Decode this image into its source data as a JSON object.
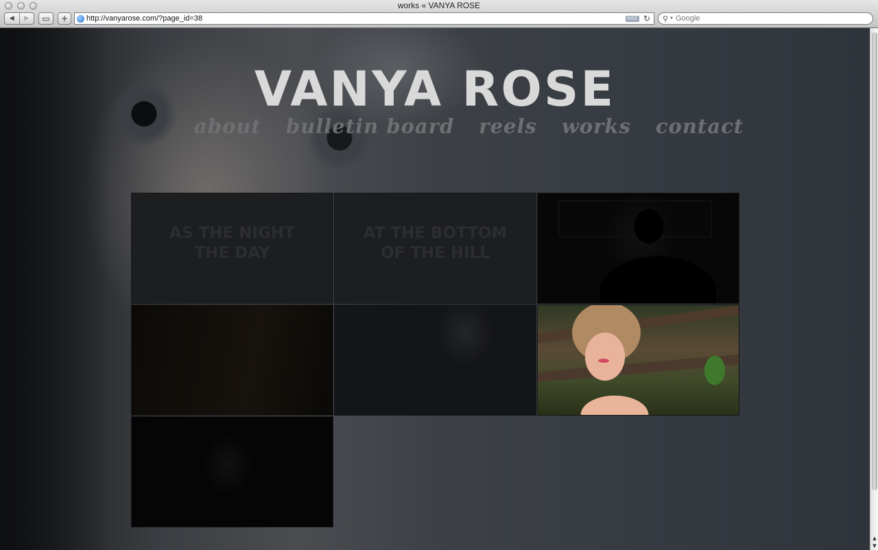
{
  "window": {
    "title": "works « VANYA ROSE"
  },
  "toolbar": {
    "back_icon": "back-arrow-icon",
    "forward_icon": "forward-arrow-icon",
    "add_bookmark_label": "+",
    "url": "http://vanyarose.com/?page_id=38",
    "rss_label": "RSS",
    "search_placeholder": "Google"
  },
  "site": {
    "title": "VANYA ROSE",
    "nav": [
      {
        "label": "about"
      },
      {
        "label": "bulletin board"
      },
      {
        "label": "reels"
      },
      {
        "label": "works"
      },
      {
        "label": "contact"
      }
    ]
  },
  "works": [
    {
      "title": "AS THE NIGHT THE DAY",
      "style": "text"
    },
    {
      "title": "AT THE BOTTOM OF THE HILL",
      "style": "text"
    },
    {
      "title": "",
      "style": "dark-silhouette"
    },
    {
      "title": "",
      "style": "dark-warm"
    },
    {
      "title": "",
      "style": "dark-figure"
    },
    {
      "title": "",
      "style": "color-photo"
    },
    {
      "title": "",
      "style": "dark-portrait"
    }
  ]
}
